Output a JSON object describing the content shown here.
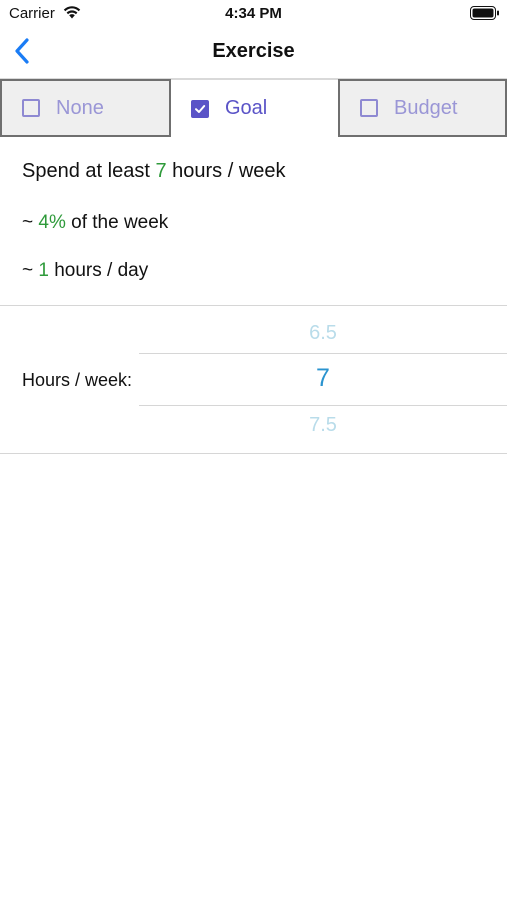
{
  "status_bar": {
    "carrier": "Carrier",
    "time": "4:34 PM",
    "wifi_icon": "wifi-icon",
    "battery_icon": "battery-full-icon"
  },
  "nav": {
    "back_icon": "chevron-left-icon",
    "title": "Exercise"
  },
  "tabs": [
    {
      "label": "None",
      "checked": false
    },
    {
      "label": "Goal",
      "checked": true
    },
    {
      "label": "Budget",
      "checked": false
    }
  ],
  "summary": {
    "line1_prefix": "Spend at least ",
    "line1_value": "7",
    "line1_suffix": " hours / week",
    "line2_prefix": "~ ",
    "line2_value": "4%",
    "line2_suffix": " of the week",
    "line3_prefix": "~ ",
    "line3_value": "1",
    "line3_suffix": " hours / day"
  },
  "picker": {
    "label": "Hours / week:",
    "options": [
      "6.5",
      "7",
      "7.5"
    ],
    "selected": "7"
  },
  "colors": {
    "accent": "#5a53c7",
    "highlight_green": "#2e9a3a",
    "picker_selected": "#2a93cf",
    "nav_blue": "#1a7cf5"
  }
}
